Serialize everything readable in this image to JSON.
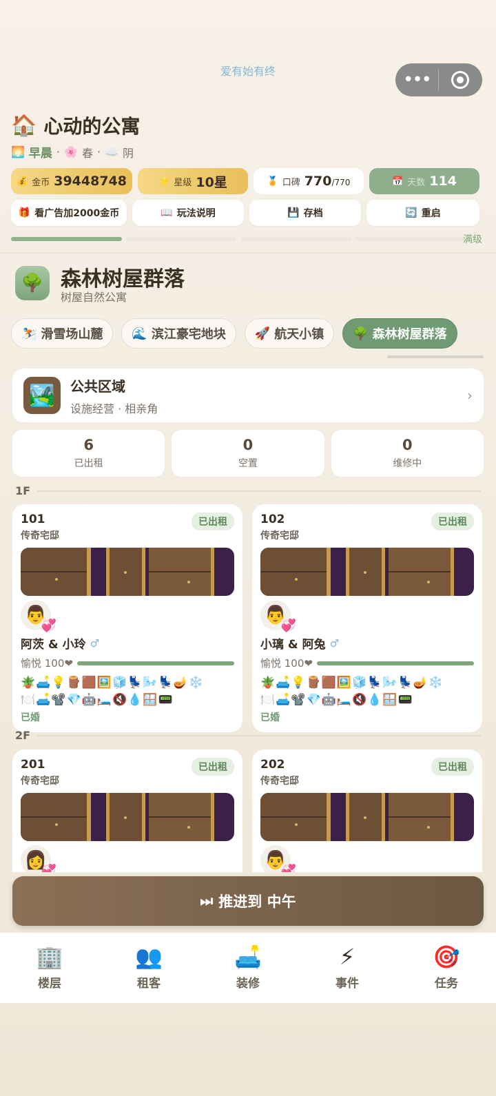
{
  "header": {
    "tagline": "爱有始有终",
    "capsule": {
      "more_icon": "ellipsis-icon",
      "close_icon": "target-icon"
    }
  },
  "title": {
    "icon": "🏠",
    "text": "心动的公寓"
  },
  "status": {
    "time_icon": "🌅",
    "time": "早晨",
    "season_icon": "🌸",
    "season": "春",
    "weather_icon": "☁️",
    "weather": "阴",
    "sep": "·"
  },
  "stats": {
    "gold": {
      "icon": "💰",
      "label": "金币",
      "value": "39448748"
    },
    "star": {
      "icon": "⭐",
      "label": "星级",
      "value": "10星"
    },
    "rep": {
      "icon": "🏅",
      "label": "口碑",
      "value": "770",
      "max": "/770"
    },
    "days": {
      "icon": "📅",
      "label": "天数",
      "value": "114"
    }
  },
  "actions": {
    "ad": {
      "icon": "🎁",
      "label": "看广告加2000金币"
    },
    "guide": {
      "icon": "📖",
      "label": "玩法说明"
    },
    "save": {
      "icon": "💾",
      "label": "存档"
    },
    "restart": {
      "icon": "🔄",
      "label": "重启"
    }
  },
  "progress": {
    "filled_segments": 1,
    "total_segments": 4,
    "label": "满级"
  },
  "zone": {
    "icon": "🌳",
    "title": "森林树屋群落",
    "subtitle": "树屋自然公寓"
  },
  "tabs": [
    {
      "icon": "⛷️",
      "label": "滑雪场山麓"
    },
    {
      "icon": "🌊",
      "label": "滨江豪宅地块"
    },
    {
      "icon": "🚀",
      "label": "航天小镇"
    },
    {
      "icon": "🌳",
      "label": "森林树屋群落",
      "active": true
    }
  ],
  "public_area": {
    "icon": "🏞️",
    "title": "公共区域",
    "subtitle": "设施经营 · 相亲角",
    "chevron": "›"
  },
  "counts": [
    {
      "value": "6",
      "label": "已出租"
    },
    {
      "value": "0",
      "label": "空置"
    },
    {
      "value": "0",
      "label": "维修中"
    }
  ],
  "floors": [
    {
      "label": "1F",
      "rooms": [
        {
          "number": "101",
          "type": "传奇宅邸",
          "status": "已出租",
          "avatar": "👨",
          "heart": "💞",
          "names": "阿茨 & 小玲",
          "gender": "♂",
          "mood": "愉悦 100❤",
          "mood_level": 1.0,
          "icons1": "🪴🛋️💡🪵🟫🖼️🧊💺🌬️💺🪔❄️",
          "icons2": "🍽️🛋️📽️💎🤖🛏️🔇💧🪟📟",
          "marital": "已婚"
        },
        {
          "number": "102",
          "type": "传奇宅邸",
          "status": "已出租",
          "avatar": "👨",
          "heart": "💞",
          "names": "小璃 & 阿兔",
          "gender": "♂",
          "mood": "愉悦 100❤",
          "mood_level": 1.0,
          "icons1": "🪴🛋️💡🪵🟫🖼️🧊💺🌬️💺🪔❄️",
          "icons2": "🍽️🛋️📽️💎🤖🛏️🔇💧🪟📟",
          "marital": "已婚"
        }
      ]
    },
    {
      "label": "2F",
      "rooms": [
        {
          "number": "201",
          "type": "传奇宅邸",
          "status": "已出租",
          "avatar": "👩",
          "heart": "💞"
        },
        {
          "number": "202",
          "type": "传奇宅邸",
          "status": "已出租",
          "avatar": "👨",
          "heart": "💞"
        }
      ]
    }
  ],
  "advance_button": {
    "icon": "⏭",
    "label": "推进到 中午"
  },
  "bottom_nav": [
    {
      "icon": "🏢",
      "label": "楼层"
    },
    {
      "icon": "👥",
      "label": "租客"
    },
    {
      "icon": "🛋️",
      "label": "装修"
    },
    {
      "icon": "⚡",
      "label": "事件"
    },
    {
      "icon": "🎯",
      "label": "任务"
    }
  ],
  "colors": {
    "accent_green": "#6f9a73",
    "gold": "#e9bf5a",
    "brown_button": "#7a6249",
    "door_purple": "#3b2147"
  }
}
